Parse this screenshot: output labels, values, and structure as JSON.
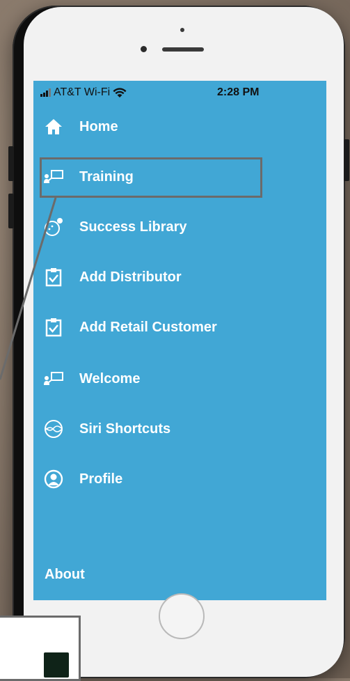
{
  "status_bar": {
    "carrier": "AT&T Wi-Fi",
    "time": "2:28 PM"
  },
  "menu": {
    "items": [
      {
        "label": "Home",
        "icon": "home-icon"
      },
      {
        "label": "Training",
        "icon": "training-icon"
      },
      {
        "label": "Success Library",
        "icon": "success-library-icon"
      },
      {
        "label": "Add Distributor",
        "icon": "clipboard-check-icon"
      },
      {
        "label": "Add Retail Customer",
        "icon": "clipboard-check-icon"
      },
      {
        "label": "Welcome",
        "icon": "training-icon"
      },
      {
        "label": "Siri Shortcuts",
        "icon": "siri-icon"
      },
      {
        "label": "Profile",
        "icon": "profile-icon"
      }
    ],
    "about_label": "About"
  },
  "colors": {
    "screen_bg": "#41a7d5",
    "text": "#ffffff",
    "callout": "#6b6b6b"
  }
}
